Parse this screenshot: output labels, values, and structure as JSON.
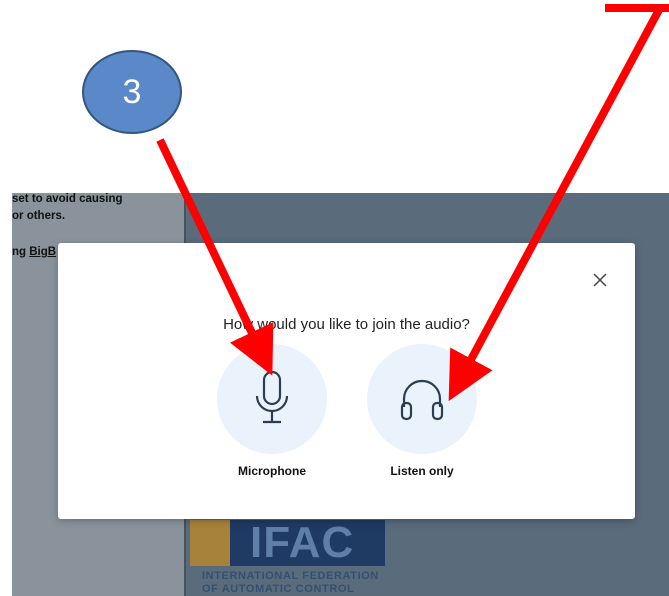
{
  "background_app": {
    "left_panel_lines": [
      "set to avoid causing",
      "or others."
    ],
    "left_panel_link_prefix": "ng ",
    "left_panel_link": "BigB"
  },
  "logo": {
    "text": "IFAC",
    "line1": "INTERNATIONAL FEDERATION",
    "line2": "OF AUTOMATIC CONTROL"
  },
  "modal": {
    "title": "How would you like to join the audio?",
    "close_icon": "close-icon",
    "options": [
      {
        "label": "Microphone",
        "icon": "microphone-icon"
      },
      {
        "label": "Listen only",
        "icon": "headphones-icon"
      }
    ]
  },
  "annotation": {
    "step_number": "3",
    "arrow_color": "#ff0000",
    "badge_color": "#5a88c8"
  }
}
